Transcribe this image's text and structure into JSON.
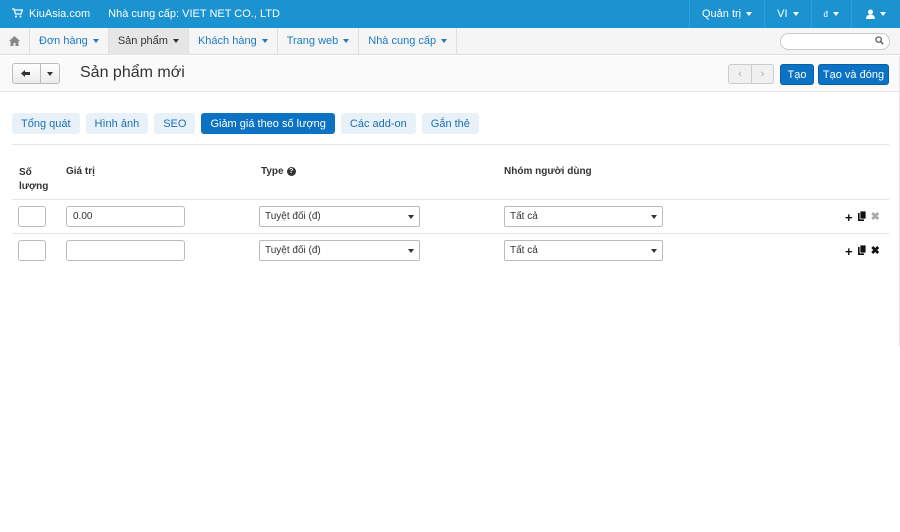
{
  "topbar": {
    "brand": "KiuAsia.com",
    "vendor": "Nhà cung cấp: VIET NET CO., LTD",
    "admin": "Quản trị",
    "lang": "VI",
    "currency": "đ",
    "colors": {
      "bg": "#1a93d0"
    }
  },
  "navbar": {
    "items": [
      {
        "label": "Đơn hàng"
      },
      {
        "label": "Sản phẩm"
      },
      {
        "label": "Khách hàng"
      },
      {
        "label": "Trang web"
      },
      {
        "label": "Nhà cung cấp"
      }
    ],
    "active_index": 1,
    "search_placeholder": ""
  },
  "titlebar": {
    "title": "Sản phẩm mới",
    "create_label": "Tạo",
    "create_close_label": "Tạo và đóng"
  },
  "tabs": [
    {
      "label": "Tổng quát"
    },
    {
      "label": "Hình ảnh"
    },
    {
      "label": "SEO"
    },
    {
      "label": "Giảm giá theo số lượng"
    },
    {
      "label": "Các add-on"
    },
    {
      "label": "Gắn thẻ"
    }
  ],
  "active_tab": 3,
  "table": {
    "headers": {
      "qty_line1": "Số",
      "qty_line2": "lượng",
      "value": "Giá trị",
      "type": "Type",
      "group": "Nhóm người dùng"
    },
    "rows": [
      {
        "qty": "",
        "value": "0.00",
        "type": "Tuyệt đối (đ)",
        "group": "Tất cả"
      },
      {
        "qty": "",
        "value": "",
        "type": "Tuyệt đối (đ)",
        "group": "Tất cả"
      }
    ]
  }
}
